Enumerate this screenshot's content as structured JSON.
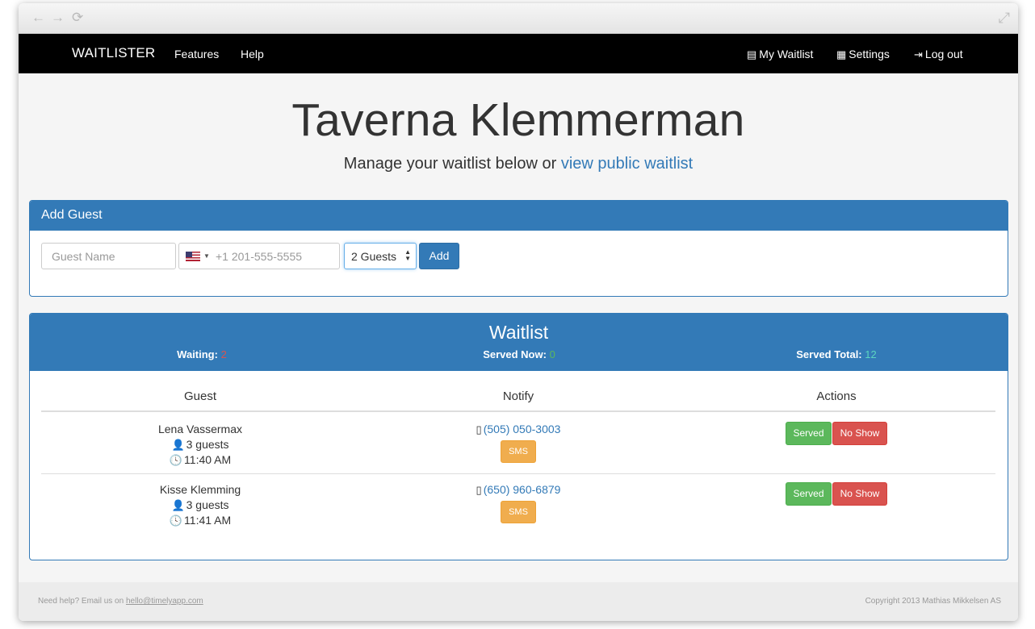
{
  "browser": {
    "back_icon": "←",
    "forward_icon": "→",
    "reload_icon": "⟳",
    "expand_icon": "⤢"
  },
  "navbar": {
    "brand": "WAITLISTER",
    "left_links": [
      "Features",
      "Help"
    ],
    "right_links": [
      {
        "icon": "▤",
        "label": "My Waitlist"
      },
      {
        "icon": "▦",
        "label": "Settings"
      },
      {
        "icon": "⇥",
        "label": "Log out"
      }
    ]
  },
  "hero": {
    "title": "Taverna Klemmerman",
    "subtitle_prefix": "Manage your waitlist below or ",
    "subtitle_link": "view public waitlist"
  },
  "add_guest": {
    "title": "Add Guest",
    "name_placeholder": "Guest Name",
    "phone_placeholder": "+1 201-555-5555",
    "party_size": "2 Guests",
    "add_label": "Add"
  },
  "waitlist": {
    "title": "Waitlist",
    "stats": {
      "waiting_label": "Waiting:",
      "waiting_value": "2",
      "served_now_label": "Served Now:",
      "served_now_value": "0",
      "served_total_label": "Served Total:",
      "served_total_value": "12"
    },
    "columns": [
      "Guest",
      "Notify",
      "Actions"
    ],
    "rows": [
      {
        "name": "Lena Vassermax",
        "guests": "3 guests",
        "time": "11:40 AM",
        "phone": "(505) 050-3003",
        "sms": "SMS",
        "served": "Served",
        "no_show": "No Show"
      },
      {
        "name": "Kisse Klemming",
        "guests": "3 guests",
        "time": "11:41 AM",
        "phone": "(650) 960-6879",
        "sms": "SMS",
        "served": "Served",
        "no_show": "No Show"
      }
    ]
  },
  "footer": {
    "help_text": "Need help? Email us on ",
    "email": "hello@timelyapp.com",
    "copyright": "Copyright 2013 Mathias Mikkelsen AS"
  },
  "colors": {
    "primary": "#337ab7",
    "waiting_value": "#d9534f",
    "served_value": "#5cb85c",
    "served_total_value": "#5cd6c0",
    "sms": "#f0ad4e"
  }
}
